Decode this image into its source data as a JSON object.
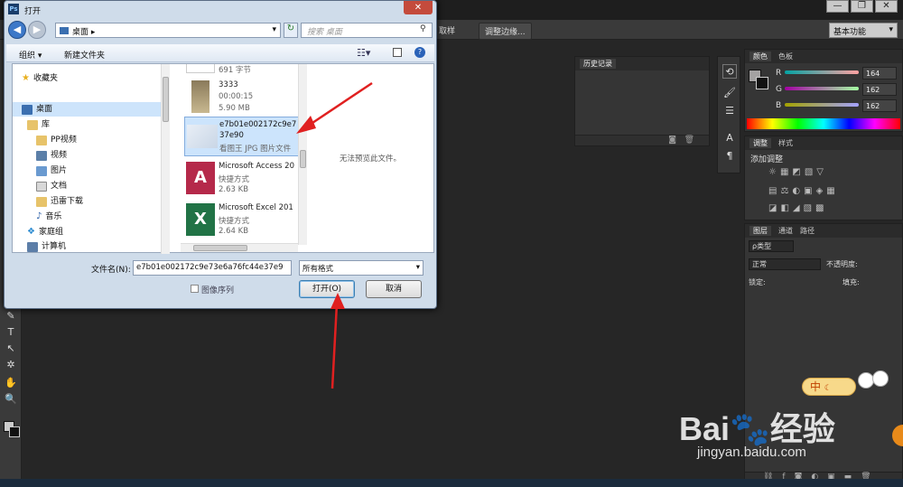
{
  "ps": {
    "options": {
      "sample_btn": "取样",
      "adjust_btn": "调整边缘..."
    },
    "workspace": "基本功能",
    "window_controls": [
      "—",
      "❐",
      "✕"
    ],
    "history_panel": {
      "title": "历史记录"
    },
    "color_panel": {
      "tabs": [
        "颜色",
        "色板"
      ],
      "channels": [
        {
          "label": "R",
          "value": "164"
        },
        {
          "label": "G",
          "value": "162"
        },
        {
          "label": "B",
          "value": "162"
        }
      ]
    },
    "adjust_panel": {
      "tabs": [
        "调整",
        "样式"
      ],
      "heading": "添加调整"
    },
    "layers_panel": {
      "tabs": [
        "图层",
        "通道",
        "路径"
      ],
      "kind": "ρ类型",
      "mode": "正常",
      "opacity_label": "不透明度:",
      "lock_label": "锁定:",
      "fill_label": "填充:"
    }
  },
  "dialog": {
    "title": "打开",
    "close": "✕",
    "address": "桌面 ▸",
    "search_placeholder": "搜索 桌面",
    "toolbar": {
      "organize": "组织 ▾",
      "new_folder": "新建文件夹"
    },
    "nav": [
      {
        "label": "收藏夹",
        "icon": "star-icon"
      },
      {
        "label": "桌面",
        "icon": "desktop-icon"
      },
      {
        "label": "库",
        "icon": "library-icon"
      },
      {
        "label": "PP视频",
        "icon": "folder-icon"
      },
      {
        "label": "视频",
        "icon": "video-icon"
      },
      {
        "label": "图片",
        "icon": "picture-icon"
      },
      {
        "label": "文档",
        "icon": "document-icon"
      },
      {
        "label": "迅雷下载",
        "icon": "download-icon"
      },
      {
        "label": "音乐",
        "icon": "music-icon"
      },
      {
        "label": "家庭组",
        "icon": "homegroup-icon"
      },
      {
        "label": "计算机",
        "icon": "computer-icon"
      }
    ],
    "files": [
      {
        "line1": "691 字节",
        "line2": "",
        "line3": ""
      },
      {
        "line1": "3333",
        "line2": "00:00:15",
        "line3": "5.90 MB"
      },
      {
        "line1": "e7b01e002172c9e7",
        "line2": "37e90",
        "line3": "看图王 JPG 图片文件"
      },
      {
        "line1": "Microsoft Access 20",
        "line2": "快捷方式",
        "line3": "2.63 KB"
      },
      {
        "line1": "Microsoft Excel 201",
        "line2": "快捷方式",
        "line3": "2.64 KB"
      }
    ],
    "preview_text": "无法预览此文件。",
    "filename_label": "文件名(N):",
    "filename_value": "e7b01e002172c9e73e6a76fc44e37e9",
    "filetype_value": "所有格式",
    "image_sequence": "图像序列",
    "open_btn": "打开(O)",
    "cancel_btn": "取消"
  },
  "ime": {
    "label": "中"
  },
  "watermark": {
    "brand": "Bai",
    "brand2": "经验",
    "url": "jingyan.baidu.com"
  }
}
